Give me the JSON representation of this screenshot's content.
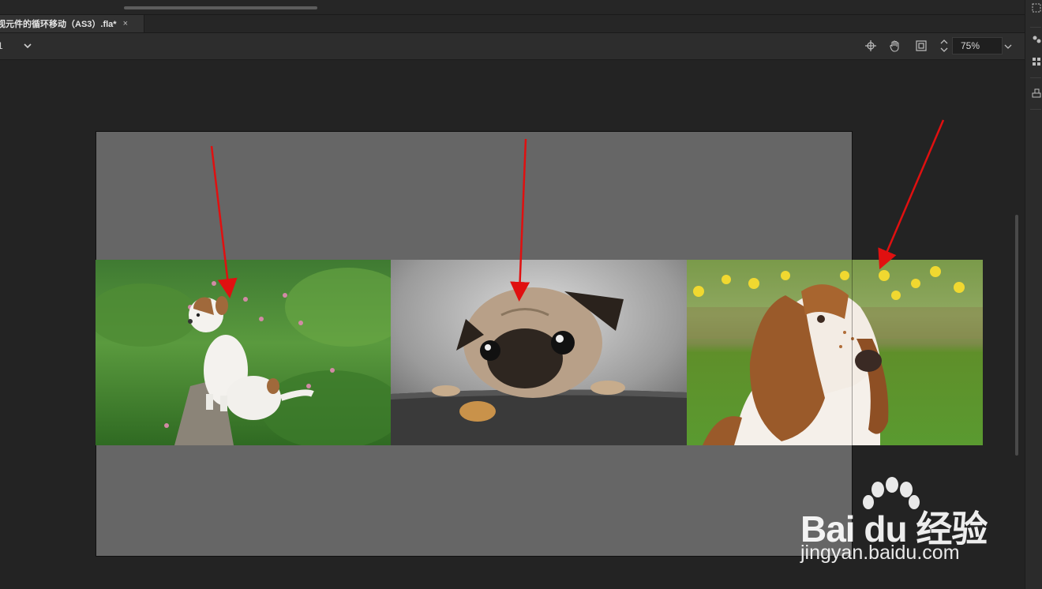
{
  "document_tab": {
    "title": "视元件的循环移动（AS3）.fla*",
    "close_glyph": "×"
  },
  "toolbar": {
    "scene_label": "1",
    "zoom_value": "75%"
  },
  "stage": {
    "background": "#666666",
    "photos": [
      {
        "name": "puppy-photo",
        "subject": "white-brown-puppy"
      },
      {
        "name": "pug-photo",
        "subject": "pug-with-cookie"
      },
      {
        "name": "basset-photo",
        "subject": "basset-hound"
      }
    ]
  },
  "annotations": {
    "arrow_color": "#e01010",
    "arrow_count": 3
  },
  "watermark": {
    "brand": "Bai du 经验",
    "url": "jingyan.baidu.com"
  }
}
